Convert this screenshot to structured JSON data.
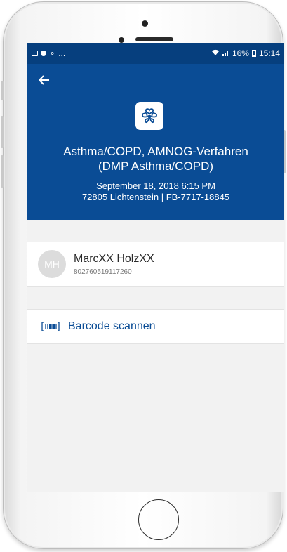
{
  "status_bar": {
    "left_icons": [
      "gallery-icon",
      "chat-bubble-icon",
      "no-signal-icon"
    ],
    "left_overflow": "...",
    "right_icons": [
      "wifi-icon",
      "signal-bars-icon",
      "battery-icon"
    ],
    "battery": "16%",
    "time": "15:14"
  },
  "header": {
    "back_icon": "back-arrow-icon",
    "logo_icon": "hearts-cluster-logo-icon",
    "title_line1": "Asthma/COPD, AMNOG-Verfahren",
    "title_line2": "(DMP Asthma/COPD)",
    "date": "September 18, 2018 6:15 PM",
    "location_line": "72805 Lichtenstein | FB-7717-18845"
  },
  "patient": {
    "initials": "MH",
    "name": "MarcXX HolzXX",
    "id_number": "802760519117260"
  },
  "barcode": {
    "icon": "barcode-icon",
    "label": "Barcode scannen"
  },
  "colors": {
    "status_bar": "#063f7e",
    "header": "#0a4c95",
    "accent_text": "#0a4c95",
    "screen_background": "#f2f2f2",
    "avatar_background": "#dcdcdc"
  }
}
